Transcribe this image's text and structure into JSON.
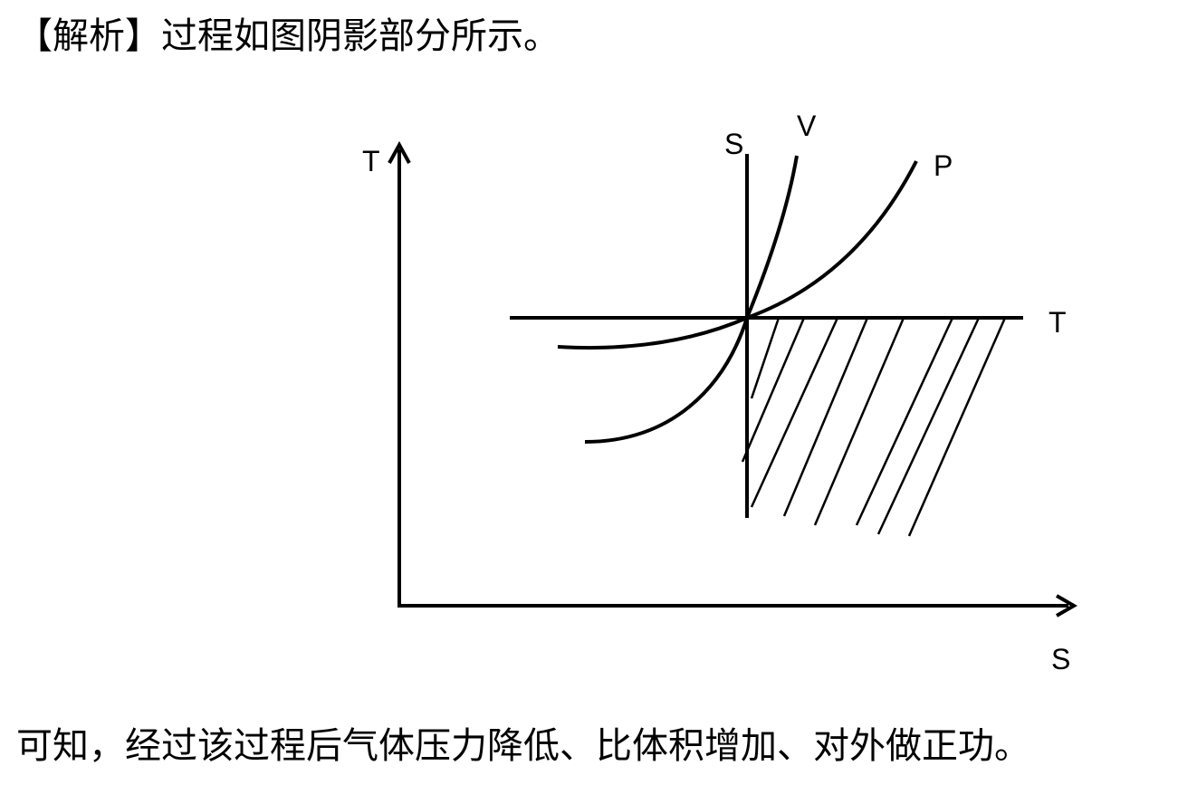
{
  "intro_text": "【解析】过程如图阴影部分所示。",
  "conclusion_text": "可知，经过该过程后气体压力降低、比体积增加、对外做正功。",
  "diagram": {
    "axis_y_label": "T",
    "axis_x_label": "S",
    "isentrope_label": "S",
    "isochore_label": "V",
    "isobar_label": "P",
    "isotherm_label": "T"
  },
  "colors": {
    "ink": "#000000",
    "background": "#ffffff"
  }
}
